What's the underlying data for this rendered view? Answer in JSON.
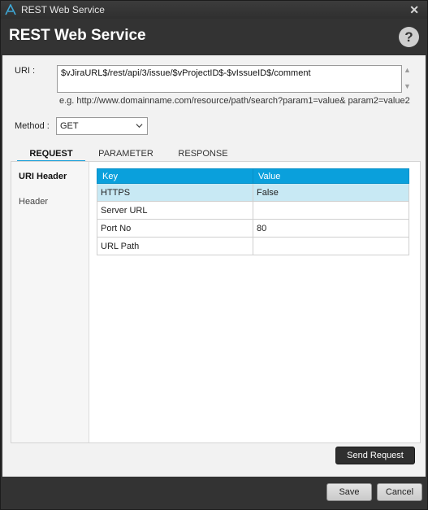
{
  "window": {
    "title": "REST Web Service",
    "close_glyph": "✕"
  },
  "header": {
    "title": "REST Web Service",
    "help_glyph": "?"
  },
  "uri": {
    "label": "URI :",
    "value": "$vJiraURL$/rest/api/3/issue/$vProjectID$-$vIssueID$/comment",
    "example": "e.g. http://www.domainname.com/resource/path/search?param1=value& param2=value2"
  },
  "method": {
    "label": "Method :",
    "selected": "GET"
  },
  "tabs": [
    {
      "label": "REQUEST",
      "active": true
    },
    {
      "label": "PARAMETER",
      "active": false
    },
    {
      "label": "RESPONSE",
      "active": false
    }
  ],
  "left_nav": {
    "items": [
      "URI Header",
      "Header"
    ]
  },
  "grid": {
    "columns": [
      "Key",
      "Value"
    ],
    "rows": [
      [
        "HTTPS",
        "False"
      ],
      [
        "Server URL",
        ""
      ],
      [
        "Port No",
        "80"
      ],
      [
        "URL Path",
        ""
      ]
    ]
  },
  "buttons": {
    "send": "Send Request",
    "save": "Save",
    "cancel": "Cancel"
  },
  "colors": {
    "accent": "#0aa0dc",
    "selected_row": "#c8e9f4",
    "chrome": "#333333"
  }
}
